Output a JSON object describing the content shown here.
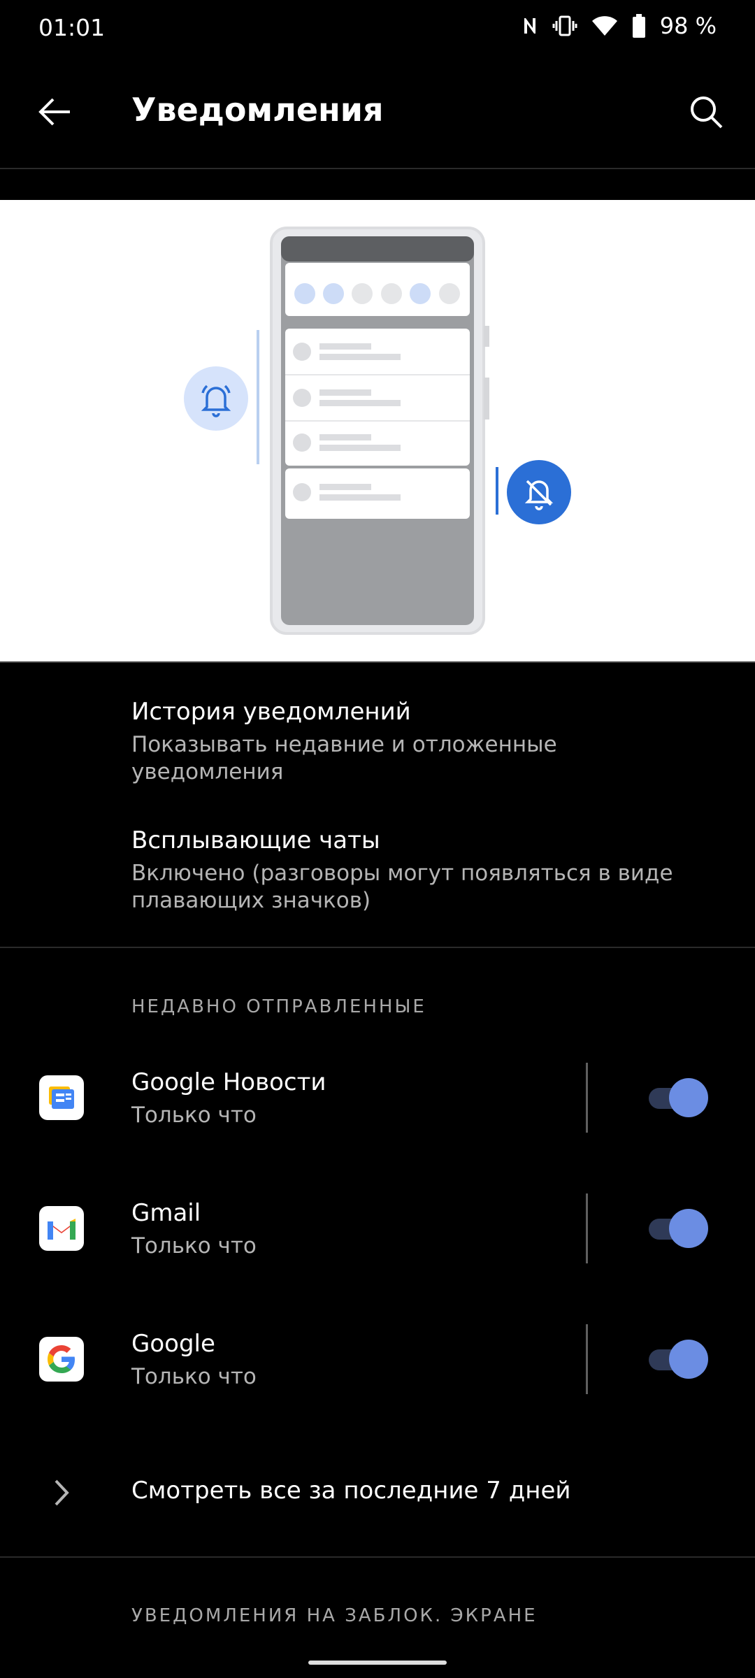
{
  "status_bar": {
    "time": "01:01",
    "battery": "98 %",
    "icons": [
      "nfc-icon",
      "vibrate-icon",
      "wifi-icon",
      "battery-icon"
    ]
  },
  "app_bar": {
    "title": "Уведомления",
    "back_icon": "back-arrow-icon",
    "search_icon": "search-icon"
  },
  "settings": {
    "history": {
      "title": "История уведомлений",
      "subtitle": "Показывать недавние и отложенные уведомления"
    },
    "bubbles": {
      "title": "Всплывающие чаты",
      "subtitle": "Включено (разговоры могут появляться в виде плавающих значков)"
    }
  },
  "recent": {
    "header": "НЕДАВНО ОТПРАВЛЕННЫЕ",
    "apps": [
      {
        "name": "Google Новости",
        "time": "Только что",
        "enabled": true
      },
      {
        "name": "Gmail",
        "time": "Только что",
        "enabled": true
      },
      {
        "name": "Google",
        "time": "Только что",
        "enabled": true
      }
    ],
    "see_all": "Смотреть все за последние 7 дней"
  },
  "lockscreen_header": "УВЕДОМЛЕНИЯ НА ЗАБЛОК. ЭКРАНЕ",
  "colors": {
    "accent": "#6b8de3",
    "toggle_track": "#2f3a57",
    "illustration_blue": "#2b6fd6"
  }
}
